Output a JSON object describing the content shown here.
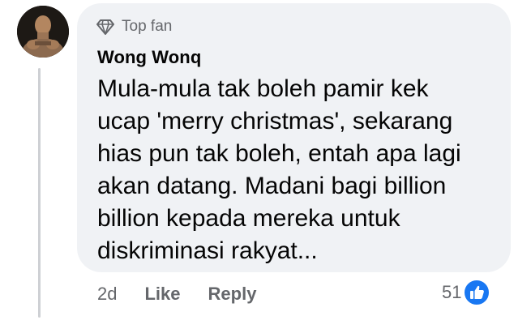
{
  "comment": {
    "badge_label": "Top fan",
    "badge_icon": "diamond-icon",
    "author": "Wong Wonq",
    "text": "Mula-mula tak boleh pamir kek ucap 'merry christmas', sekarang hias pun tak boleh, entah apa lagi akan datang. Madani bagi billion billion kepada mereka untuk diskriminasi rakyat...",
    "timestamp": "2d",
    "like_label": "Like",
    "reply_label": "Reply",
    "reaction_count": "51",
    "reaction_icon": "like-thumb-icon"
  },
  "colors": {
    "bubble_bg": "#f0f2f5",
    "secondary_text": "#65676b",
    "like_blue": "#1877f2",
    "thread_line": "#ced0d4"
  }
}
